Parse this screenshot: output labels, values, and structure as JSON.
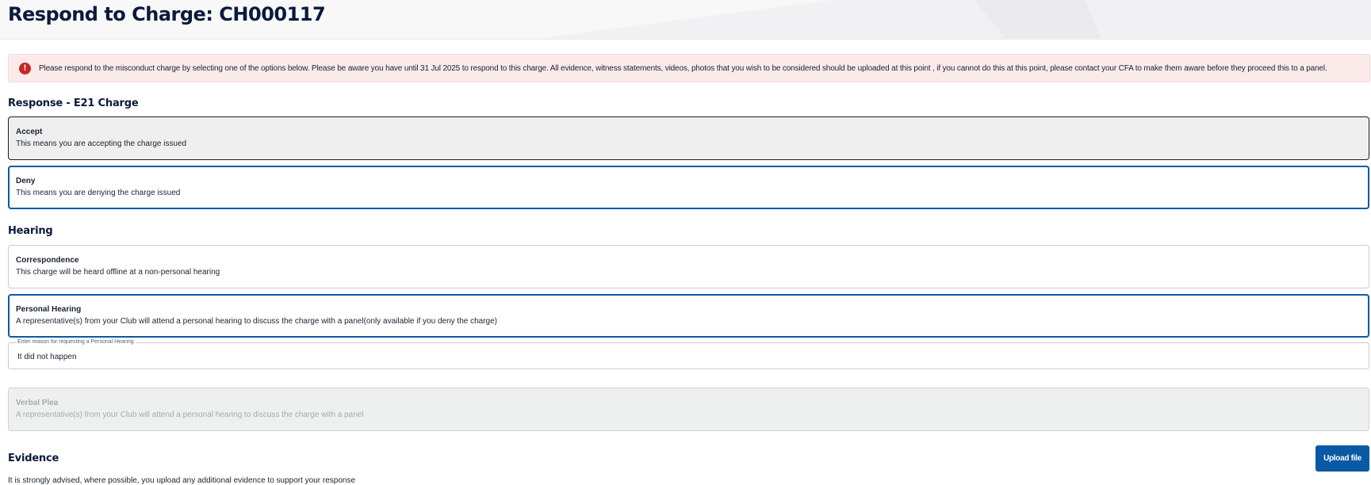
{
  "header": {
    "title": "Respond to Charge: CH000117"
  },
  "alert": {
    "icon": "error-icon",
    "icon_glyph": "!",
    "color": "#c62828",
    "text": "Please respond to the misconduct charge by selecting one of the options below. Please be aware you have until 31 Jul 2025 to respond to this charge. All evidence, witness statements, videos, photos that you wish to be considered should be uploaded at this point , if you cannot do this at this point, please contact your CFA to make them aware before they proceed this to a panel."
  },
  "response": {
    "title": "Response - E21 Charge",
    "options": [
      {
        "title": "Accept",
        "description": "This means you are accepting the charge issued"
      },
      {
        "title": "Deny",
        "description": "This means you are denying the charge issued",
        "selected": true
      }
    ]
  },
  "hearing": {
    "title": "Hearing",
    "options": [
      {
        "title": "Correspondence",
        "description": "This charge will be heard offline at a non-personal hearing"
      },
      {
        "title": "Personal Hearing",
        "description": "A representative(s) from your Club will attend a personal hearing to discuss the charge with a panel(only available if you deny the charge)",
        "selected": true
      },
      {
        "title": "Verbal Plea",
        "description": "A representative(s) from your Club will attend a personal hearing to discuss the charge with a panel",
        "disabled": true
      }
    ],
    "reason_label": "Enter reason for requesting a Personal Hearing",
    "reason_value": "It did not happen"
  },
  "evidence": {
    "title": "Evidence",
    "upload_label": "Upload file",
    "help_text": "It is strongly advised, where possible, you upload any additional evidence to support your response"
  },
  "colors": {
    "primary": "#0a59a5",
    "text": "#0b1a3b",
    "alert_bg": "#fbeaea",
    "disabled_bg": "#eeefef"
  }
}
